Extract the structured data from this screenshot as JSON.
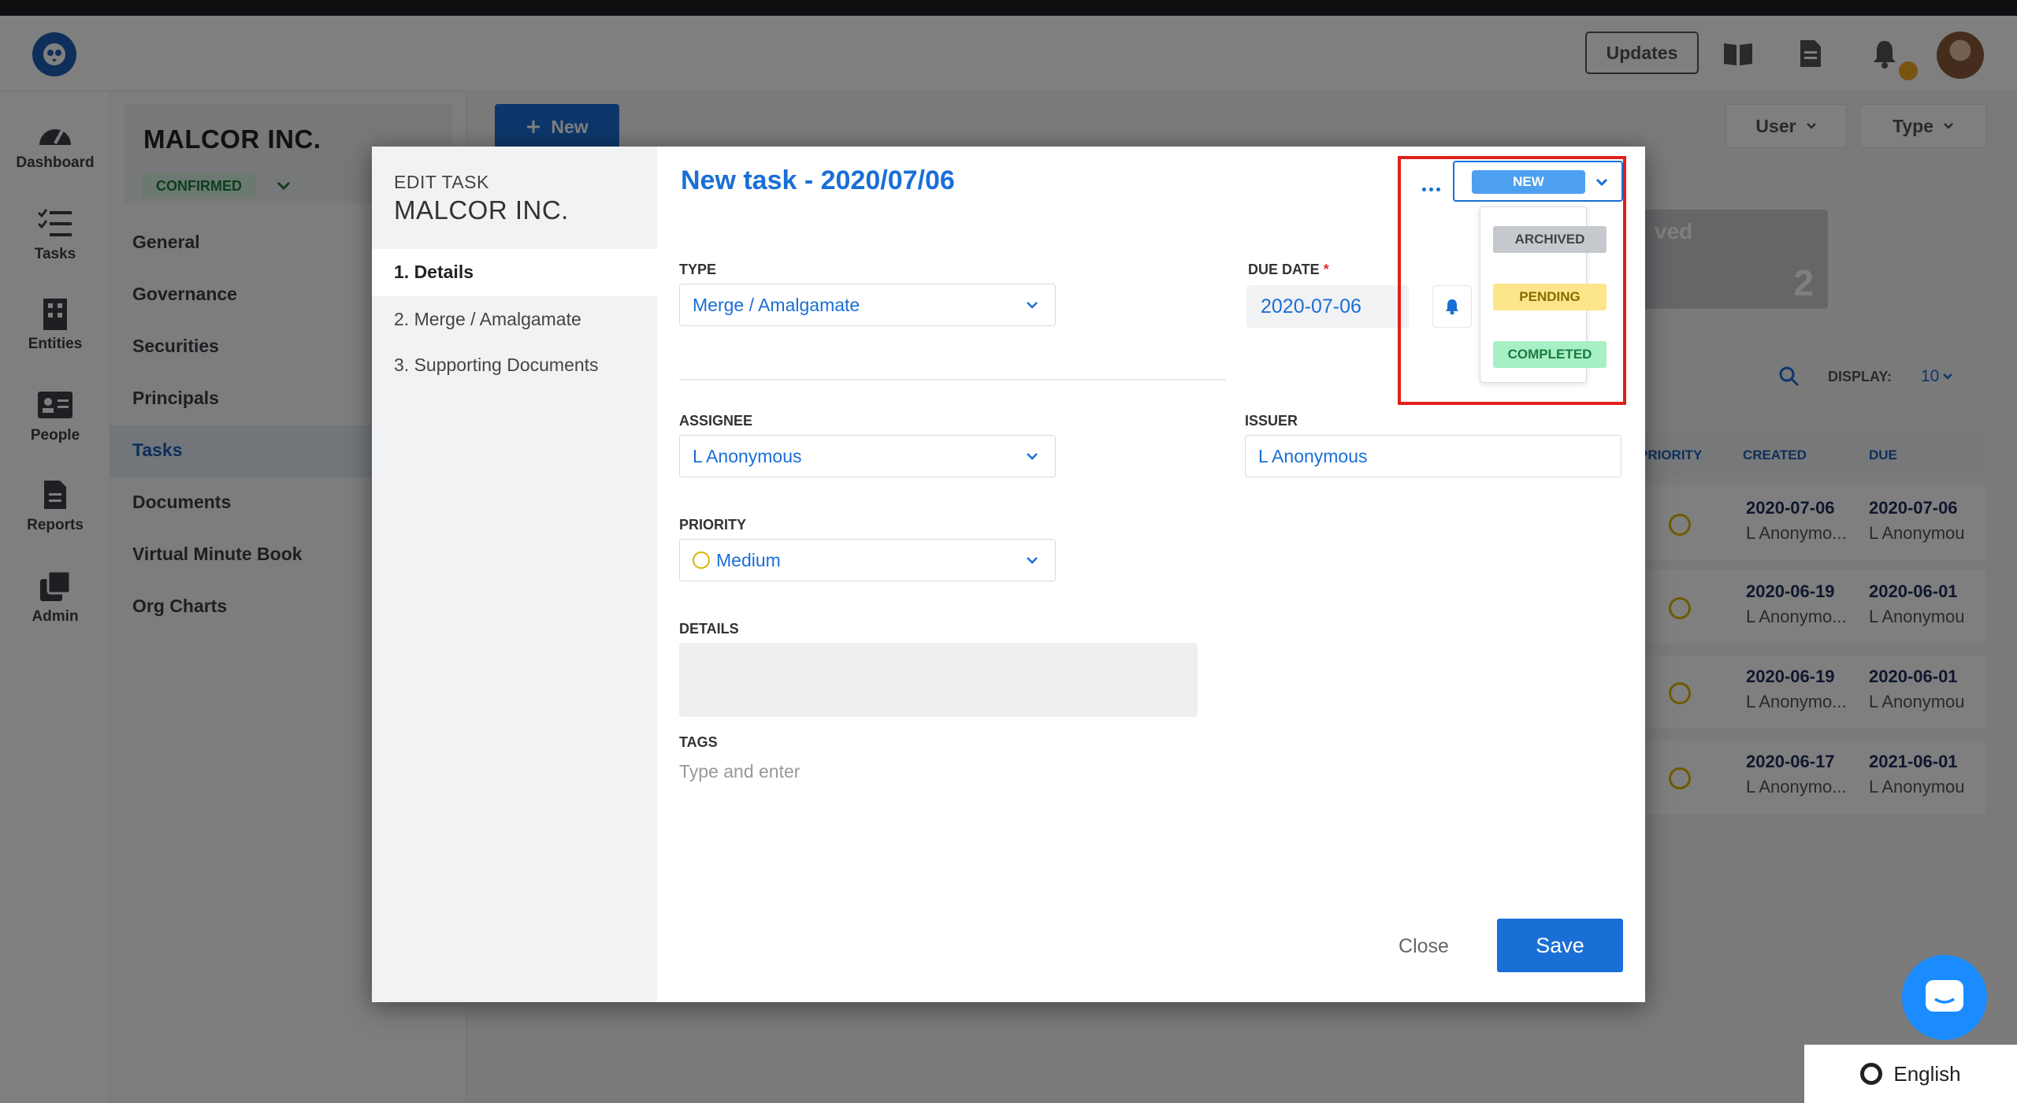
{
  "topbar": {
    "updates_label": "Updates"
  },
  "nav": {
    "items": [
      {
        "label": "Dashboard"
      },
      {
        "label": "Tasks"
      },
      {
        "label": "Entities"
      },
      {
        "label": "People"
      },
      {
        "label": "Reports"
      },
      {
        "label": "Admin"
      }
    ]
  },
  "entity": {
    "name": "MALCOR INC.",
    "status": "CONFIRMED",
    "links": [
      "General",
      "Governance",
      "Securities",
      "Principals",
      "Tasks",
      "Documents",
      "Virtual Minute Book",
      "Org Charts"
    ],
    "active_link": "Tasks"
  },
  "main": {
    "new_label": "New",
    "filters": {
      "user": "User",
      "type": "Type"
    },
    "stat_card": {
      "title": "ved",
      "count": "2"
    },
    "display_label": "DISPLAY:",
    "display_value": "10",
    "table": {
      "headers": {
        "priority": "PRIORITY",
        "created": "CREATED",
        "due": "DUE"
      },
      "rows": [
        {
          "created": "2020-07-06",
          "created_by": "L Anonymo...",
          "due": "2020-07-06",
          "due_by": "L Anonymou"
        },
        {
          "created": "2020-06-19",
          "created_by": "L Anonymo...",
          "due": "2020-06-01",
          "due_by": "L Anonymou"
        },
        {
          "created": "2020-06-19",
          "created_by": "L Anonymo...",
          "due": "2020-06-01",
          "due_by": "L Anonymou"
        },
        {
          "created": "2020-06-17",
          "created_by": "L Anonymo...",
          "due": "2021-06-01",
          "due_by": "L Anonymou"
        }
      ]
    }
  },
  "modal": {
    "edit_label": "EDIT TASK",
    "entity_name": "MALCOR INC.",
    "steps": [
      "1. Details",
      "2. Merge / Amalgamate",
      "3. Supporting Documents"
    ],
    "title": "New task - 2020/07/06",
    "type": {
      "label": "TYPE",
      "value": "Merge / Amalgamate"
    },
    "due_date": {
      "label": "DUE DATE",
      "required_mark": "*",
      "value": "2020-07-06"
    },
    "assignee": {
      "label": "ASSIGNEE",
      "value": "L Anonymous"
    },
    "issuer": {
      "label": "ISSUER",
      "value": "L Anonymous"
    },
    "priority": {
      "label": "PRIORITY",
      "value": "Medium"
    },
    "details": {
      "label": "DETAILS",
      "value": ""
    },
    "tags": {
      "label": "TAGS",
      "placeholder": "Type and enter"
    },
    "status": {
      "current": "NEW",
      "options": [
        {
          "label": "ARCHIVED",
          "bg": "#c5c8cc",
          "fg": "#444444"
        },
        {
          "label": "PENDING",
          "bg": "#fde68a",
          "fg": "#8a6a00"
        },
        {
          "label": "COMPLETED",
          "bg": "#a7f0c6",
          "fg": "#1b7a3d"
        }
      ]
    },
    "close_label": "Close",
    "save_label": "Save"
  },
  "footer": {
    "language": "English"
  },
  "colors": {
    "accent": "#1a6fd6",
    "highlight": "#e0201a",
    "status_new": "#4da0f0"
  }
}
